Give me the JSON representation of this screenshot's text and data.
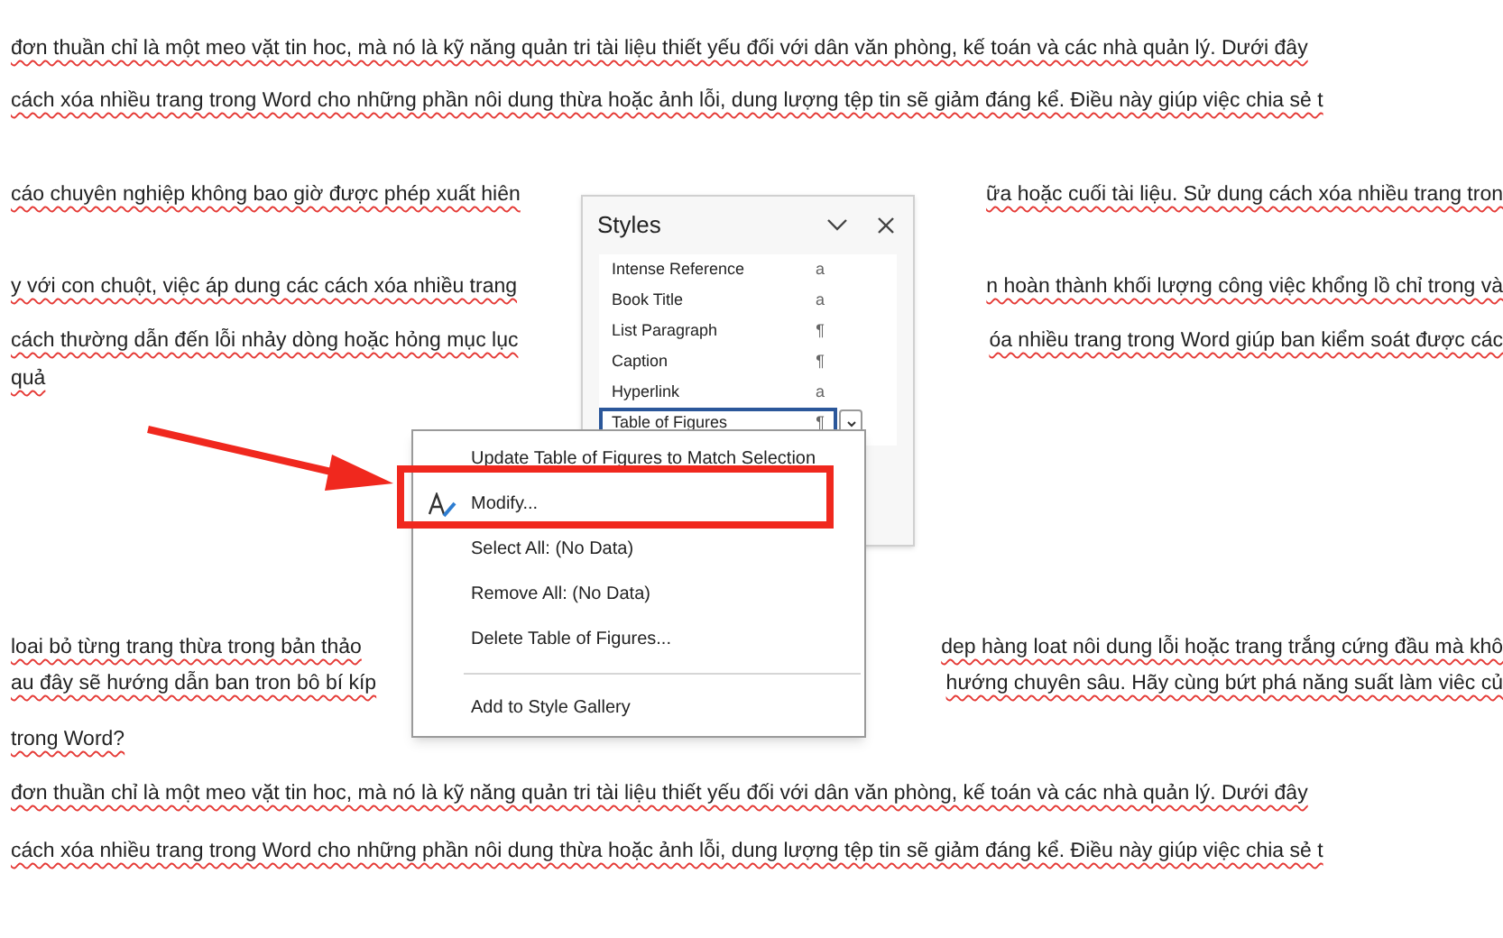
{
  "document": {
    "lines": [
      {
        "left": "đơn thuần chỉ là một meo vặt tin hoc, mà nó là kỹ năng quản tri tài liệu thiết yếu đối với dân văn phòng, kế toán và các nhà quản lý. Dưới đây"
      },
      {
        "left": "cách xóa nhiều trang trong Word cho những phần nôi dung thừa hoặc ảnh lỗi, dung lượng tệp tin sẽ giảm đáng kể. Điều này giúp việc chia sẻ t"
      },
      {
        "left": "cáo chuyên nghiệp không bao giờ được phép xuất hiên",
        "right": "ữa hoặc cuối tài liệu. Sử dung cách xóa nhiều trang tron"
      },
      {
        "left": "y với con chuột, việc áp dung các cách xóa nhiều trang",
        "right": "n hoàn thành khối lượng công việc khổng lồ chỉ trong và"
      },
      {
        "left": "cách thường dẫn đến lỗi nhảy dòng hoặc hỏng mục lục",
        "right": "óa nhiều trang trong Word giúp ban kiểm soát được các"
      },
      {
        "left": "quả"
      },
      {
        "left": "loai bỏ từng trang thừa trong bản thảo",
        "right": "dep hàng loat nôi dung lỗi hoặc trang trắng cứng đầu mà khô"
      },
      {
        "left": "au đây sẽ hướng dẫn ban tron bô bí kíp",
        "right": "hướng chuyên sâu. Hãy cùng bứt phá năng suất làm viêc củ"
      },
      {
        "left": "trong Word?"
      },
      {
        "left": "đơn thuần chỉ là một meo vặt tin hoc, mà nó là kỹ năng quản tri tài liệu thiết yếu đối với dân văn phòng, kế toán và các nhà quản lý. Dưới đây"
      },
      {
        "left": "cách xóa nhiều trang trong Word cho những phần nôi dung thừa hoặc ảnh lỗi, dung lượng tệp tin sẽ giảm đáng kể. Điều này giúp việc chia sẻ t"
      }
    ]
  },
  "styles_pane": {
    "title": "Styles",
    "items": [
      {
        "label": "Intense Reference",
        "symbol": "a",
        "selected": false
      },
      {
        "label": "Book Title",
        "symbol": "a",
        "selected": false
      },
      {
        "label": "List Paragraph",
        "symbol": "¶",
        "selected": false
      },
      {
        "label": "Caption",
        "symbol": "¶",
        "selected": false
      },
      {
        "label": "Hyperlink",
        "symbol": "a",
        "selected": false
      },
      {
        "label": "Table of Figures",
        "symbol": "¶",
        "selected": true
      }
    ]
  },
  "context_menu": {
    "items": [
      {
        "label": "Update Table of Figures to Match Selection",
        "kind": "item"
      },
      {
        "label": "Modify...",
        "kind": "icon_item"
      },
      {
        "label": "Select All: (No Data)",
        "kind": "item"
      },
      {
        "label": "Remove All: (No Data)",
        "kind": "item"
      },
      {
        "label": "Delete Table of Figures...",
        "kind": "item"
      },
      {
        "kind": "separator"
      },
      {
        "label": "Add to Style Gallery",
        "kind": "item"
      }
    ]
  }
}
